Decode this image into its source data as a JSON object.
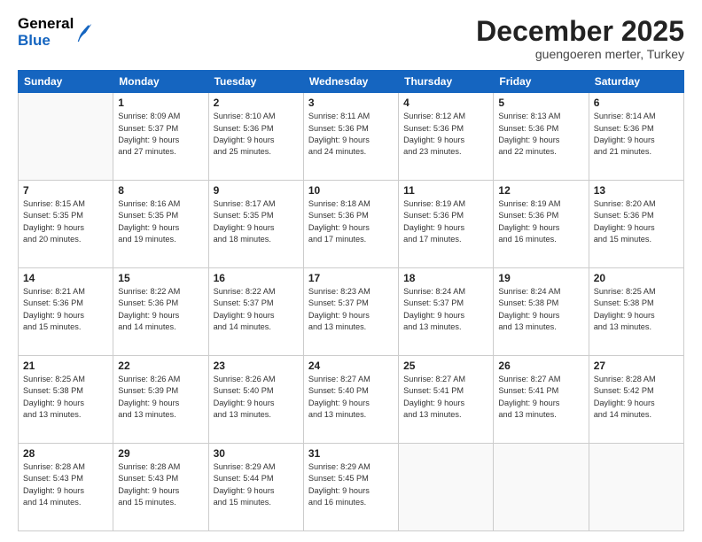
{
  "header": {
    "logo_general": "General",
    "logo_blue": "Blue",
    "month_title": "December 2025",
    "subtitle": "guengoeren merter, Turkey"
  },
  "weekdays": [
    "Sunday",
    "Monday",
    "Tuesday",
    "Wednesday",
    "Thursday",
    "Friday",
    "Saturday"
  ],
  "weeks": [
    [
      {
        "day": "",
        "info": ""
      },
      {
        "day": "1",
        "info": "Sunrise: 8:09 AM\nSunset: 5:37 PM\nDaylight: 9 hours\nand 27 minutes."
      },
      {
        "day": "2",
        "info": "Sunrise: 8:10 AM\nSunset: 5:36 PM\nDaylight: 9 hours\nand 25 minutes."
      },
      {
        "day": "3",
        "info": "Sunrise: 8:11 AM\nSunset: 5:36 PM\nDaylight: 9 hours\nand 24 minutes."
      },
      {
        "day": "4",
        "info": "Sunrise: 8:12 AM\nSunset: 5:36 PM\nDaylight: 9 hours\nand 23 minutes."
      },
      {
        "day": "5",
        "info": "Sunrise: 8:13 AM\nSunset: 5:36 PM\nDaylight: 9 hours\nand 22 minutes."
      },
      {
        "day": "6",
        "info": "Sunrise: 8:14 AM\nSunset: 5:36 PM\nDaylight: 9 hours\nand 21 minutes."
      }
    ],
    [
      {
        "day": "7",
        "info": "Sunrise: 8:15 AM\nSunset: 5:35 PM\nDaylight: 9 hours\nand 20 minutes."
      },
      {
        "day": "8",
        "info": "Sunrise: 8:16 AM\nSunset: 5:35 PM\nDaylight: 9 hours\nand 19 minutes."
      },
      {
        "day": "9",
        "info": "Sunrise: 8:17 AM\nSunset: 5:35 PM\nDaylight: 9 hours\nand 18 minutes."
      },
      {
        "day": "10",
        "info": "Sunrise: 8:18 AM\nSunset: 5:36 PM\nDaylight: 9 hours\nand 17 minutes."
      },
      {
        "day": "11",
        "info": "Sunrise: 8:19 AM\nSunset: 5:36 PM\nDaylight: 9 hours\nand 17 minutes."
      },
      {
        "day": "12",
        "info": "Sunrise: 8:19 AM\nSunset: 5:36 PM\nDaylight: 9 hours\nand 16 minutes."
      },
      {
        "day": "13",
        "info": "Sunrise: 8:20 AM\nSunset: 5:36 PM\nDaylight: 9 hours\nand 15 minutes."
      }
    ],
    [
      {
        "day": "14",
        "info": "Sunrise: 8:21 AM\nSunset: 5:36 PM\nDaylight: 9 hours\nand 15 minutes."
      },
      {
        "day": "15",
        "info": "Sunrise: 8:22 AM\nSunset: 5:36 PM\nDaylight: 9 hours\nand 14 minutes."
      },
      {
        "day": "16",
        "info": "Sunrise: 8:22 AM\nSunset: 5:37 PM\nDaylight: 9 hours\nand 14 minutes."
      },
      {
        "day": "17",
        "info": "Sunrise: 8:23 AM\nSunset: 5:37 PM\nDaylight: 9 hours\nand 13 minutes."
      },
      {
        "day": "18",
        "info": "Sunrise: 8:24 AM\nSunset: 5:37 PM\nDaylight: 9 hours\nand 13 minutes."
      },
      {
        "day": "19",
        "info": "Sunrise: 8:24 AM\nSunset: 5:38 PM\nDaylight: 9 hours\nand 13 minutes."
      },
      {
        "day": "20",
        "info": "Sunrise: 8:25 AM\nSunset: 5:38 PM\nDaylight: 9 hours\nand 13 minutes."
      }
    ],
    [
      {
        "day": "21",
        "info": "Sunrise: 8:25 AM\nSunset: 5:38 PM\nDaylight: 9 hours\nand 13 minutes."
      },
      {
        "day": "22",
        "info": "Sunrise: 8:26 AM\nSunset: 5:39 PM\nDaylight: 9 hours\nand 13 minutes."
      },
      {
        "day": "23",
        "info": "Sunrise: 8:26 AM\nSunset: 5:40 PM\nDaylight: 9 hours\nand 13 minutes."
      },
      {
        "day": "24",
        "info": "Sunrise: 8:27 AM\nSunset: 5:40 PM\nDaylight: 9 hours\nand 13 minutes."
      },
      {
        "day": "25",
        "info": "Sunrise: 8:27 AM\nSunset: 5:41 PM\nDaylight: 9 hours\nand 13 minutes."
      },
      {
        "day": "26",
        "info": "Sunrise: 8:27 AM\nSunset: 5:41 PM\nDaylight: 9 hours\nand 13 minutes."
      },
      {
        "day": "27",
        "info": "Sunrise: 8:28 AM\nSunset: 5:42 PM\nDaylight: 9 hours\nand 14 minutes."
      }
    ],
    [
      {
        "day": "28",
        "info": "Sunrise: 8:28 AM\nSunset: 5:43 PM\nDaylight: 9 hours\nand 14 minutes."
      },
      {
        "day": "29",
        "info": "Sunrise: 8:28 AM\nSunset: 5:43 PM\nDaylight: 9 hours\nand 15 minutes."
      },
      {
        "day": "30",
        "info": "Sunrise: 8:29 AM\nSunset: 5:44 PM\nDaylight: 9 hours\nand 15 minutes."
      },
      {
        "day": "31",
        "info": "Sunrise: 8:29 AM\nSunset: 5:45 PM\nDaylight: 9 hours\nand 16 minutes."
      },
      {
        "day": "",
        "info": ""
      },
      {
        "day": "",
        "info": ""
      },
      {
        "day": "",
        "info": ""
      }
    ]
  ]
}
